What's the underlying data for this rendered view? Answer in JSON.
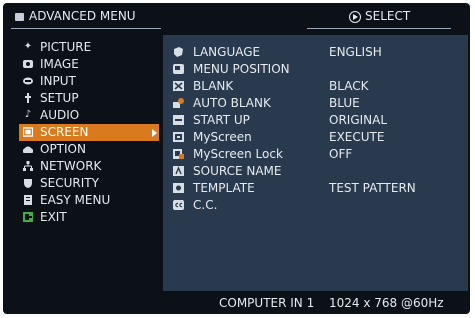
{
  "header": {
    "title": "ADVANCED MENU",
    "select_label": "SELECT",
    "title_icon": "menu-icon",
    "select_icon": "select-button-icon"
  },
  "left_menu": {
    "items": [
      {
        "label": "PICTURE",
        "icon": "picture-icon"
      },
      {
        "label": "IMAGE",
        "icon": "image-icon"
      },
      {
        "label": "INPUT",
        "icon": "input-icon"
      },
      {
        "label": "SETUP",
        "icon": "setup-icon"
      },
      {
        "label": "AUDIO",
        "icon": "audio-icon"
      },
      {
        "label": "SCREEN",
        "icon": "screen-icon",
        "active": true
      },
      {
        "label": "OPTION",
        "icon": "option-icon"
      },
      {
        "label": "NETWORK",
        "icon": "network-icon"
      },
      {
        "label": "SECURITY",
        "icon": "security-icon"
      },
      {
        "label": "EASY MENU",
        "icon": "easy-menu-icon"
      },
      {
        "label": "EXIT",
        "icon": "exit-icon"
      }
    ]
  },
  "screen_menu": {
    "rows": [
      {
        "label": "LANGUAGE",
        "value": "ENGLISH",
        "icon": "language-icon"
      },
      {
        "label": "MENU POSITION",
        "value": "",
        "icon": "menu-position-icon"
      },
      {
        "label": "BLANK",
        "value": "BLACK",
        "icon": "blank-icon"
      },
      {
        "label": "AUTO BLANK",
        "value": "BLUE",
        "icon": "auto-blank-icon"
      },
      {
        "label": "START UP",
        "value": "ORIGINAL",
        "icon": "start-up-icon"
      },
      {
        "label": "MyScreen",
        "value": "EXECUTE",
        "icon": "myscreen-icon"
      },
      {
        "label": "MyScreen Lock",
        "value": "OFF",
        "icon": "myscreen-lock-icon"
      },
      {
        "label": "SOURCE NAME",
        "value": "",
        "icon": "source-name-icon"
      },
      {
        "label": "TEMPLATE",
        "value": "TEST PATTERN",
        "icon": "template-icon"
      },
      {
        "label": "C.C.",
        "value": "",
        "icon": "closed-caption-icon"
      }
    ]
  },
  "status": {
    "source": "COMPUTER IN 1",
    "resolution": "1024 x 768 @60Hz"
  },
  "colors": {
    "background": "#0c1118",
    "panel": "#2a3a4e",
    "highlight": "#d97a1e",
    "text": "#e6ebf0"
  }
}
